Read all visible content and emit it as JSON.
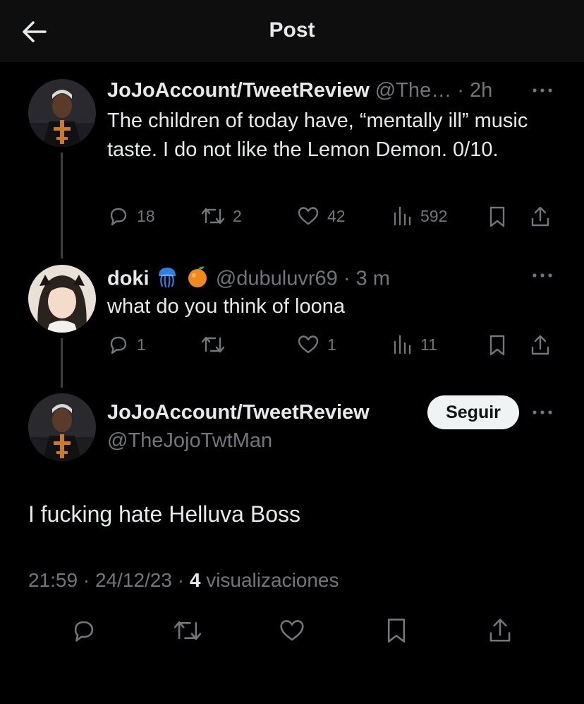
{
  "header": {
    "title": "Post"
  },
  "tweets": [
    {
      "display_name": "JoJoAccount/TweetReview",
      "handle": "@The…",
      "time": "· 2h",
      "text": "The children of today have, “mentally ill” music taste. I do not like the Lemon Demon. 0/10.",
      "replies": "18",
      "retweets": "2",
      "likes": "42",
      "views": "592"
    },
    {
      "display_name": "doki",
      "handle": "@dubuluvr69",
      "time": "· 3 m",
      "text": "what do you think of loona",
      "replies": "1",
      "retweets": "",
      "likes": "1",
      "views": "11"
    }
  ],
  "main_tweet": {
    "display_name": "JoJoAccount/TweetReview",
    "handle": "@TheJojoTwtMan",
    "follow_label": "Seguir",
    "text": "I fucking hate Helluva Boss",
    "timestamp": "21:59 · 24/12/23 ·",
    "view_count": "4",
    "view_label": "visualizaciones"
  },
  "icons": {
    "back": "arrow-left-icon",
    "more": "more-dots-icon",
    "reply": "reply-icon",
    "retweet": "retweet-icon",
    "like": "heart-icon",
    "views": "views-bars-icon",
    "bookmark": "bookmark-icon",
    "share": "share-icon",
    "emoji_1": "jellyfish-emoji",
    "emoji_2": "tangerine-emoji"
  },
  "colors": {
    "background": "#000000",
    "text": "#e7e9ea",
    "muted": "#71767b",
    "follow_bg": "#eff3f4"
  }
}
